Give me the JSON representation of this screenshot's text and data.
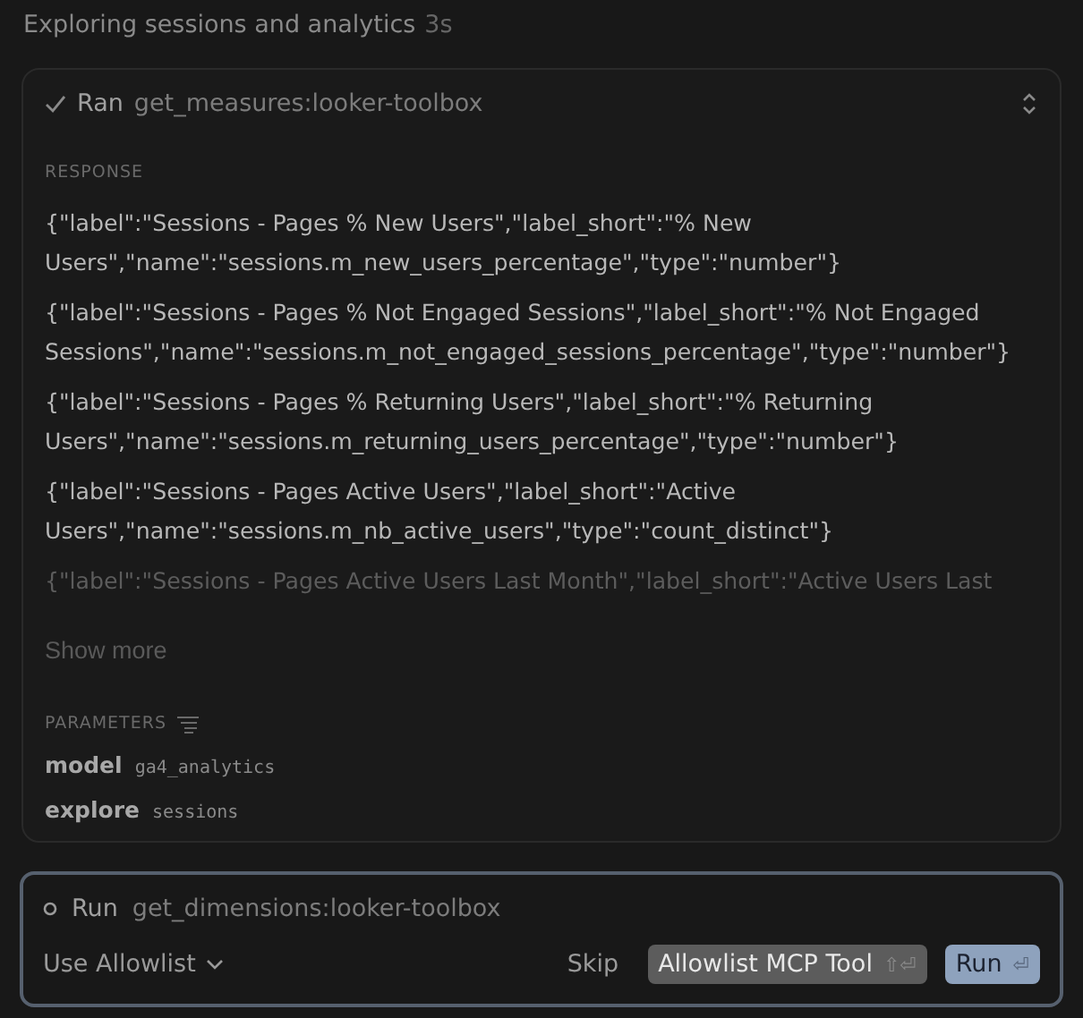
{
  "header": {
    "title": "Exploring sessions and analytics",
    "duration": "3s"
  },
  "completed_call": {
    "status": "Ran",
    "tool": "get_measures:looker-toolbox",
    "expanded": true,
    "response_label": "RESPONSE",
    "response_lines": [
      {
        "text": "{\"label\":\"Sessions - Pages % New Users\",\"label_short\":\"% New Users\",\"name\":\"sessions.m_new_users_percentage\",\"type\":\"number\"}",
        "faded": false
      },
      {
        "text": "{\"label\":\"Sessions - Pages % Not Engaged Sessions\",\"label_short\":\"% Not Engaged Sessions\",\"name\":\"sessions.m_not_engaged_sessions_percentage\",\"type\":\"number\"}",
        "faded": false
      },
      {
        "text": "{\"label\":\"Sessions - Pages % Returning Users\",\"label_short\":\"% Returning Users\",\"name\":\"sessions.m_returning_users_percentage\",\"type\":\"number\"}",
        "faded": false
      },
      {
        "text": "{\"label\":\"Sessions - Pages Active Users\",\"label_short\":\"Active Users\",\"name\":\"sessions.m_nb_active_users\",\"type\":\"count_distinct\"}",
        "faded": false
      },
      {
        "text": "{\"label\":\"Sessions - Pages Active Users Last Month\",\"label_short\":\"Active Users Last",
        "faded": true
      }
    ],
    "show_more": "Show more",
    "parameters_label": "PARAMETERS",
    "parameters": [
      {
        "name": "model",
        "value": "ga4_analytics"
      },
      {
        "name": "explore",
        "value": "sessions"
      }
    ]
  },
  "pending_call": {
    "status": "Run",
    "tool": "get_dimensions:looker-toolbox",
    "allowlist_menu": "Use Allowlist",
    "buttons": [
      {
        "kind": "text",
        "label": "Skip"
      },
      {
        "kind": "secondary",
        "label": "Allowlist MCP Tool",
        "shortcut": "⇧⏎"
      },
      {
        "kind": "primary",
        "label": "Run",
        "shortcut": "⏎"
      }
    ]
  }
}
